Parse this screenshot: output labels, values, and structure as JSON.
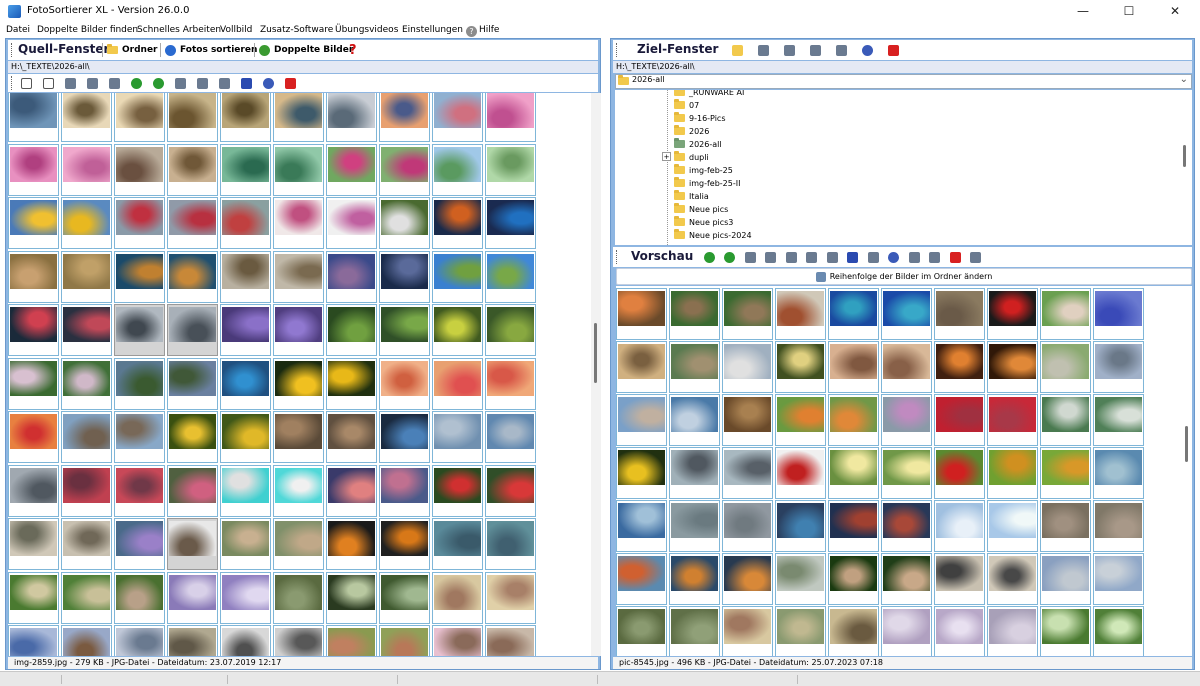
{
  "window": {
    "title": "FotoSortierer XL - Version 26.0.0",
    "min": "—",
    "max": "☐",
    "close": "✕"
  },
  "menu": {
    "items": [
      {
        "label": "Datei"
      },
      {
        "label": "Doppelte Bilder finden"
      },
      {
        "label": "Schnelles Arbeiten"
      },
      {
        "label": "Vollbild"
      },
      {
        "label": "Zusatz-Software"
      },
      {
        "label": "Übungsvideos"
      },
      {
        "label": "Einstellungen"
      },
      {
        "label": "Hilfe"
      }
    ]
  },
  "left": {
    "title": "Quell-Fenster",
    "ordner_label": "Ordner",
    "sortieren_label": "Fotos sortieren",
    "doppelte_label": "Doppelte Bilder",
    "help_glyph": "?",
    "path": "H:\\_TEXTE\\2026-all\\",
    "status": "img-2859.jpg - 279 KB - JPG-Datei - Dateidatum: 23.07.2019 12:17",
    "toolbar_icons": [
      "check-all-icon",
      "uncheck-all-icon",
      "sort-icon",
      "grid-view-icon",
      "tag-icon",
      "rotate-left-icon",
      "rotate-right-icon",
      "move-icon",
      "document-icon",
      "zoom-icon",
      "d-icon",
      "undo-icon",
      "delete-icon"
    ]
  },
  "right": {
    "title": "Ziel-Fenster",
    "path": "H:\\_TEXTE\\2026-all\\",
    "combo_value": "2026-all",
    "combo_arrow": "⌄",
    "tree": [
      {
        "label": "_RUNWARE AI",
        "expander": false,
        "green": false
      },
      {
        "label": "07",
        "expander": false,
        "green": false
      },
      {
        "label": "9-16-Pics",
        "expander": false,
        "green": false
      },
      {
        "label": "2026",
        "expander": false,
        "green": false
      },
      {
        "label": "2026-all",
        "expander": false,
        "green": true
      },
      {
        "label": "dupli",
        "expander": true,
        "green": false
      },
      {
        "label": "img-feb-25",
        "expander": false,
        "green": false
      },
      {
        "label": "img-feb-25-II",
        "expander": false,
        "green": false
      },
      {
        "label": "Italia",
        "expander": false,
        "green": false
      },
      {
        "label": "Neue pics",
        "expander": false,
        "green": false
      },
      {
        "label": "Neue pics3",
        "expander": false,
        "green": false
      },
      {
        "label": "Neue pics-2024",
        "expander": false,
        "green": false
      }
    ],
    "tree_expander_glyph": "+",
    "preview_title": "Vorschau",
    "reorder_label": "Reihenfolge der Bilder im Ordner ändern",
    "status": "pic-8545.jpg - 496 KB - JPG-Datei - Dateidatum: 25.07.2023 07:18",
    "toolbar_icons": [
      "new-folder-icon",
      "move-icon",
      "search-icon",
      "copy-icon",
      "paste-icon",
      "undo-icon",
      "delete-icon"
    ],
    "preview_icons": [
      "rotate-left-icon",
      "rotate-right-icon",
      "sort-icon",
      "grid-view-icon",
      "move-icon",
      "document-icon",
      "zoom-icon",
      "d-icon",
      "export-icon",
      "undo-icon",
      "slideshow-icon",
      "edit-icon",
      "delete-icon",
      "tag-icon"
    ]
  },
  "colors": {
    "frame": "#8eb6e2",
    "accent": "#1a5ab8",
    "thumb_border": "#7fb6d8"
  },
  "palettes": [
    [
      "#6f95b8",
      "#3c5a7a"
    ],
    [
      "#e8d8b8",
      "#6b5a3a"
    ],
    [
      "#ead9b5",
      "#776040"
    ],
    [
      "#c7b48a",
      "#6b5530"
    ],
    [
      "#b8a578",
      "#5a4a28"
    ],
    [
      "#d6b98a",
      "#3e5a6a"
    ],
    [
      "#c8cdd4",
      "#5a6a78"
    ],
    [
      "#e8a070",
      "#4a5a8a"
    ],
    [
      "#90b0d0",
      "#d07080"
    ],
    [
      "#f0a0c8",
      "#c05090"
    ],
    [
      "#e890c0",
      "#b04080"
    ],
    [
      "#f0a8cc",
      "#c06098"
    ],
    [
      "#b8aa98",
      "#6a5040"
    ],
    [
      "#c8b090",
      "#705838"
    ],
    [
      "#78b898",
      "#2a6a50"
    ],
    [
      "#90c8a8",
      "#3a7a58"
    ],
    [
      "#70a860",
      "#d04080"
    ],
    [
      "#80b070",
      "#c03878"
    ],
    [
      "#a0c8e8",
      "#5a9a60"
    ],
    [
      "#b0d8a8",
      "#6a9a60"
    ],
    [
      "#4a7ab8",
      "#f0c030"
    ],
    [
      "#5a8ac0",
      "#e8b820"
    ],
    [
      "#8a9aa8",
      "#c03040"
    ],
    [
      "#909aa8",
      "#b83040"
    ],
    [
      "#8aa0a0",
      "#c04040"
    ],
    [
      "#f0e8e8",
      "#c05080"
    ],
    [
      "#f0f0f0",
      "#c060a0"
    ],
    [
      "#4a6a30",
      "#e0e0e0"
    ],
    [
      "#1a2a4a",
      "#d06020"
    ],
    [
      "#1a2a50",
      "#2070c0"
    ],
    [
      "#8a7040",
      "#c8a070"
    ],
    [
      "#907848",
      "#c0a068"
    ],
    [
      "#1a4a6a",
      "#c08030"
    ],
    [
      "#205070",
      "#c88838"
    ],
    [
      "#b8b0a0",
      "#6a5a40"
    ],
    [
      "#c0b8a8",
      "#7a6a50"
    ],
    [
      "#3a4a8a",
      "#8a6a9a"
    ],
    [
      "#1a2a4a",
      "#5a6a9a"
    ],
    [
      "#3a80d0",
      "#70a040"
    ],
    [
      "#4088d8",
      "#78a848"
    ],
    [
      "#1a2a3a",
      "#d04050"
    ],
    [
      "#2a3040",
      "#c04858"
    ],
    [
      "#b0b8c0",
      "#404850"
    ],
    [
      "#a8b0b8",
      "#485058"
    ],
    [
      "#4a3a7a",
      "#8a70c8"
    ],
    [
      "#503e80",
      "#9078d0"
    ],
    [
      "#2a4a20",
      "#70a040"
    ],
    [
      "#305028",
      "#78a848"
    ],
    [
      "#405a20",
      "#c8d040"
    ],
    [
      "#3a5828",
      "#88a840"
    ],
    [
      "#3a6a30",
      "#d8c0d0"
    ],
    [
      "#407038",
      "#d0b8c8"
    ],
    [
      "#5a7890",
      "#3a5a30"
    ],
    [
      "#6a80a0",
      "#405838"
    ],
    [
      "#205080",
      "#3090d0"
    ],
    [
      "#1a2a10",
      "#f0c020"
    ],
    [
      "#20300f",
      "#e8b818"
    ],
    [
      "#f0b088",
      "#d06040"
    ],
    [
      "#e8a070",
      "#e05050"
    ],
    [
      "#f0a878",
      "#d85848"
    ],
    [
      "#e88040",
      "#d03030"
    ],
    [
      "#80a0c0",
      "#706050"
    ],
    [
      "#88a8c8",
      "#786858"
    ],
    [
      "#3a5010",
      "#e8c030"
    ],
    [
      "#405818",
      "#e0b828"
    ],
    [
      "#5a4a38",
      "#a08060"
    ],
    [
      "#605040",
      "#a88868"
    ],
    [
      "#1a2a40",
      "#4a80b8"
    ],
    [
      "#7090b0",
      "#b0c0d0"
    ],
    [
      "#6088b0",
      "#a8b8c8"
    ],
    [
      "#a0a8b0",
      "#505860"
    ],
    [
      "#c04050",
      "#6a3040"
    ],
    [
      "#c84858",
      "#703848"
    ],
    [
      "#506040",
      "#d06080"
    ],
    [
      "#40d0d0",
      "#e0e0e0"
    ],
    [
      "#50d8d8",
      "#f0f0f0"
    ],
    [
      "#3a3a6a",
      "#e08080"
    ],
    [
      "#4a5a8a",
      "#c07090"
    ],
    [
      "#2a4a20",
      "#d03030"
    ],
    [
      "#304e28",
      "#d83838"
    ],
    [
      "#d0c8b8",
      "#6a6a5a"
    ],
    [
      "#c8c0b0",
      "#706858"
    ],
    [
      "#4a6a8a",
      "#9a80c8"
    ],
    [
      "#e8e8e8",
      "#6a5a4a"
    ],
    [
      "#7a8a60",
      "#c8b090"
    ],
    [
      "#80906a",
      "#c0a888"
    ],
    [
      "#1a1a1a",
      "#e08020"
    ],
    [
      "#202020",
      "#d87818"
    ],
    [
      "#5a8a9a",
      "#3a5a6a"
    ],
    [
      "#60909a",
      "#406070"
    ],
    [
      "#4a7a30",
      "#d0c8a0"
    ],
    [
      "#508038",
      "#c8c098"
    ],
    [
      "#4a7030",
      "#b8a088"
    ],
    [
      "#8a7ab8",
      "#d8d0e8"
    ],
    [
      "#9080c0",
      "#e0d8f0"
    ],
    [
      "#5a6a40",
      "#8a9a70"
    ],
    [
      "#2a3a20",
      "#b8c8a0"
    ],
    [
      "#405a30",
      "#a0b890"
    ],
    [
      "#d8c8a0",
      "#a07860"
    ],
    [
      "#e0d0a8",
      "#a88068"
    ],
    [
      "#a8b8d8",
      "#4a6aa8"
    ],
    [
      "#98a8c8",
      "#7a5a40"
    ],
    [
      "#c0c8d8",
      "#6a7a90"
    ],
    [
      "#b0a890",
      "#605848"
    ],
    [
      "#d8d8d8",
      "#505050"
    ],
    [
      "#d0d0d0",
      "#585858"
    ],
    [
      "#8a9a50",
      "#c08060"
    ],
    [
      "#90a058",
      "#b87858"
    ],
    [
      "#e8c0d0",
      "#8a6a5a"
    ],
    [
      "#c8b8a8",
      "#8a6a58"
    ]
  ],
  "rpalettes": [
    [
      "#6a4a2a",
      "#e08040"
    ],
    [
      "#3a6a30",
      "#8a7050"
    ],
    [
      "#3a6a30",
      "#907858"
    ],
    [
      "#d0c8b8",
      "#a05030"
    ],
    [
      "#1a4aa0",
      "#30a0c0"
    ],
    [
      "#1a4aa8",
      "#38a8c8"
    ],
    [
      "#8a7a60",
      "#6a5a48"
    ],
    [
      "#1a1a1a",
      "#d02020"
    ],
    [
      "#6aa050",
      "#e0d0c0"
    ],
    [
      "#6a7ad0",
      "#3a4ab8"
    ],
    [
      "#d0b080",
      "#7a6040"
    ],
    [
      "#5a7a50",
      "#a09070"
    ],
    [
      "#a0b0c0",
      "#e0e0e0"
    ],
    [
      "#405020",
      "#e0d080"
    ],
    [
      "#d8b090",
      "#805840"
    ],
    [
      "#d8b898",
      "#886048"
    ],
    [
      "#402010",
      "#e08030"
    ],
    [
      "#301808",
      "#e08838"
    ],
    [
      "#8aaa70",
      "#c0c0b0"
    ],
    [
      "#a0b0c8",
      "#6a7888"
    ],
    [
      "#7aa0c8",
      "#c0b0a0"
    ],
    [
      "#4a7aa8",
      "#c0d0e0"
    ],
    [
      "#6a4a2a",
      "#a88050"
    ],
    [
      "#6a9a40",
      "#e08030"
    ],
    [
      "#709848",
      "#e08838"
    ],
    [
      "#8a9aa8",
      "#c08ac0"
    ],
    [
      "#c02030",
      "#a03040"
    ],
    [
      "#c82838",
      "#a83848"
    ],
    [
      "#4a7a50",
      "#d0d8d0"
    ],
    [
      "#508058",
      "#d8e0d8"
    ],
    [
      "#203010",
      "#e8c020"
    ],
    [
      "#a0b0b8",
      "#505860"
    ],
    [
      "#a8b8c0",
      "#586068"
    ],
    [
      "#f0f0f0",
      "#c02020"
    ],
    [
      "#6a9040",
      "#f0e8a0"
    ],
    [
      "#709848",
      "#f0e8a0"
    ],
    [
      "#5a8a30",
      "#d02020"
    ],
    [
      "#70a030",
      "#d09020"
    ],
    [
      "#78a838",
      "#d89828"
    ],
    [
      "#5a8ab0",
      "#a0c0d0"
    ],
    [
      "#3a6aa0",
      "#a0c0d8"
    ],
    [
      "#8a9aa0",
      "#6a7a80"
    ],
    [
      "#9098a0",
      "#707a80"
    ],
    [
      "#2a4060",
      "#4080b0"
    ],
    [
      "#203050",
      "#a04030"
    ],
    [
      "#283858",
      "#a84838"
    ],
    [
      "#a0c0e0",
      "#e8f0f8"
    ],
    [
      "#a8c8e8",
      "#f0f8f8"
    ],
    [
      "#7a7060",
      "#a09080"
    ],
    [
      "#807868",
      "#a89888"
    ],
    [
      "#5a8ab0",
      "#d06030"
    ],
    [
      "#2a4a6a",
      "#d08030"
    ],
    [
      "#283a50",
      "#d88838"
    ],
    [
      "#c0c8c0",
      "#7a8a70"
    ],
    [
      "#1a3a10",
      "#c0a080"
    ],
    [
      "#203e18",
      "#c8a888"
    ],
    [
      "#c8c0b0",
      "#404040"
    ],
    [
      "#d0c8b8",
      "#484848"
    ],
    [
      "#8aa0c0",
      "#c0c8d0"
    ],
    [
      "#90a8c8",
      "#c8d0d8"
    ],
    [
      "#5a6a40",
      "#8a9a70"
    ],
    [
      "#607048",
      "#90a078"
    ],
    [
      "#d8c8a0",
      "#a07860"
    ],
    [
      "#8a9a70",
      "#c0b890"
    ],
    [
      "#c8b890",
      "#6a5a40"
    ],
    [
      "#b0a0c0",
      "#e0d8e8"
    ],
    [
      "#b8a8c8",
      "#e8e0f0"
    ],
    [
      "#a8a0b8",
      "#d8d0e0"
    ],
    [
      "#4a7a30",
      "#c8e0b0"
    ],
    [
      "#508038",
      "#d0e8b8"
    ],
    [
      "#203050",
      "#4070a0"
    ],
    [
      "#283858",
      "#4878a8"
    ],
    [
      "#a0b0c0",
      "#e0e0e0"
    ],
    [
      "#d0c8b8",
      "#a05030"
    ],
    [
      "#1a4aa0",
      "#30a0c0"
    ],
    [
      "#6aa050",
      "#e0d0c0"
    ],
    [
      "#3a6a30",
      "#8a7050"
    ],
    [
      "#6a7ad0",
      "#3a4ab8"
    ],
    [
      "#d8b090",
      "#805840"
    ],
    [
      "#a0b0c8",
      "#6a7888"
    ]
  ]
}
